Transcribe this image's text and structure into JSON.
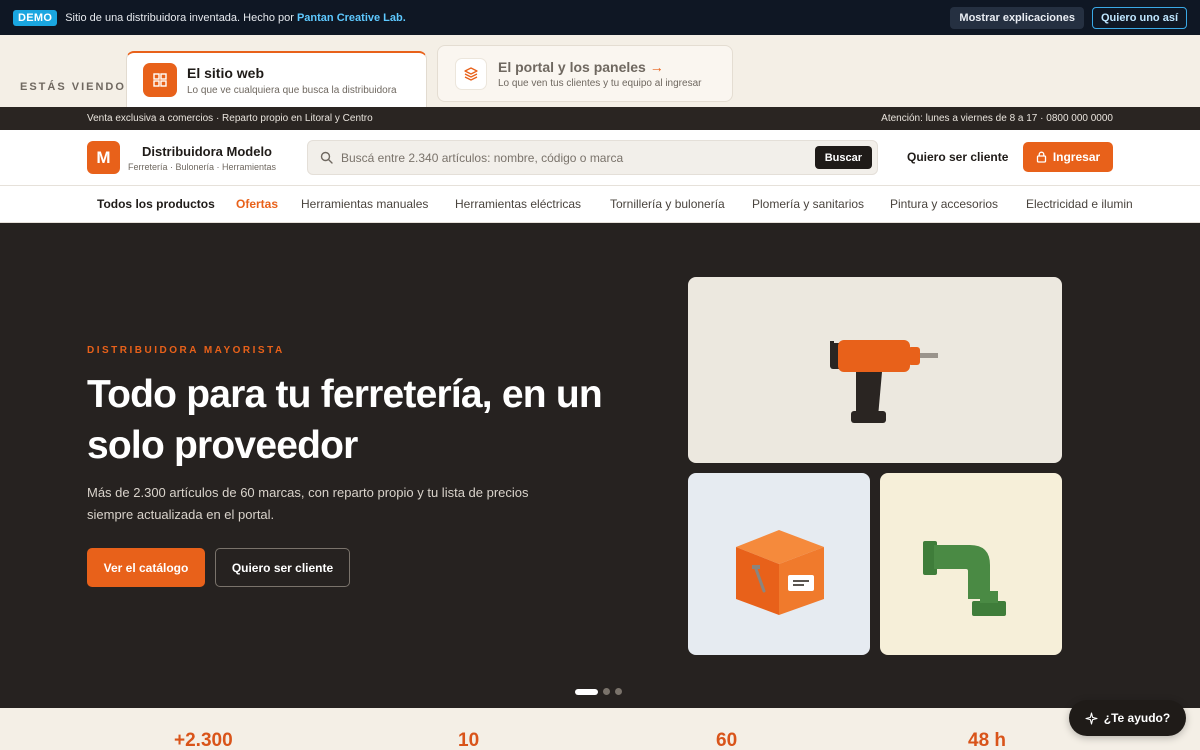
{
  "demo_bar": {
    "badge": "DEMO",
    "text": "Sitio de una distribuidora inventada. Hecho por ",
    "brand": "Pantan Creative Lab.",
    "show_explanations": "Mostrar explicaciones",
    "want_one": "Quiero uno así"
  },
  "view_switch": {
    "label": "ESTÁS VIENDO",
    "active": {
      "title": "El sitio web",
      "subtitle": "Lo que ve cualquiera que busca la distribuidora",
      "icon": "grid-icon"
    },
    "other": {
      "title": "El portal y los paneles",
      "arrow": "→",
      "subtitle": "Lo que ven tus clientes y tu equipo al ingresar",
      "icon": "layers-icon"
    }
  },
  "util_bar": {
    "left": "Venta exclusiva a comercios · Reparto propio en Litoral y Centro",
    "right": "Atención: lunes a viernes de 8 a 17 · 0800 000 0000"
  },
  "header": {
    "logo_letter": "M",
    "name": "Distribuidora Modelo",
    "tagline": "Ferretería · Bulonería · Herramientas",
    "search_placeholder": "Buscá entre 2.340 artículos: nombre, código o marca",
    "search_button": "Buscar",
    "client_link": "Quiero ser cliente",
    "login": "Ingresar"
  },
  "categories": [
    "Todos los productos",
    "Ofertas",
    "Herramientas manuales",
    "Herramientas eléctricas",
    "Tornillería y bulonería",
    "Plomería y sanitarios",
    "Pintura y accesorios",
    "Electricidad e ilumin"
  ],
  "hero": {
    "eyebrow": "DISTRIBUIDORA MAYORISTA",
    "title": "Todo para tu ferretería, en un solo proveedor",
    "subtitle": "Más de 2.300 artículos de 60 marcas, con reparto propio y tu lista de precios siempre actualizada en el portal.",
    "cta_primary": "Ver el catálogo",
    "cta_secondary": "Quiero ser cliente",
    "slide_count": 3,
    "active_slide": 1
  },
  "stats": [
    "+2.300",
    "10",
    "60",
    "48 h"
  ],
  "help": {
    "label": "¿Te ayudo?",
    "icon": "sparkle-icon"
  },
  "colors": {
    "accent": "#e8611a",
    "hero_bg": "#262220",
    "demo_bg": "#0f1724"
  }
}
